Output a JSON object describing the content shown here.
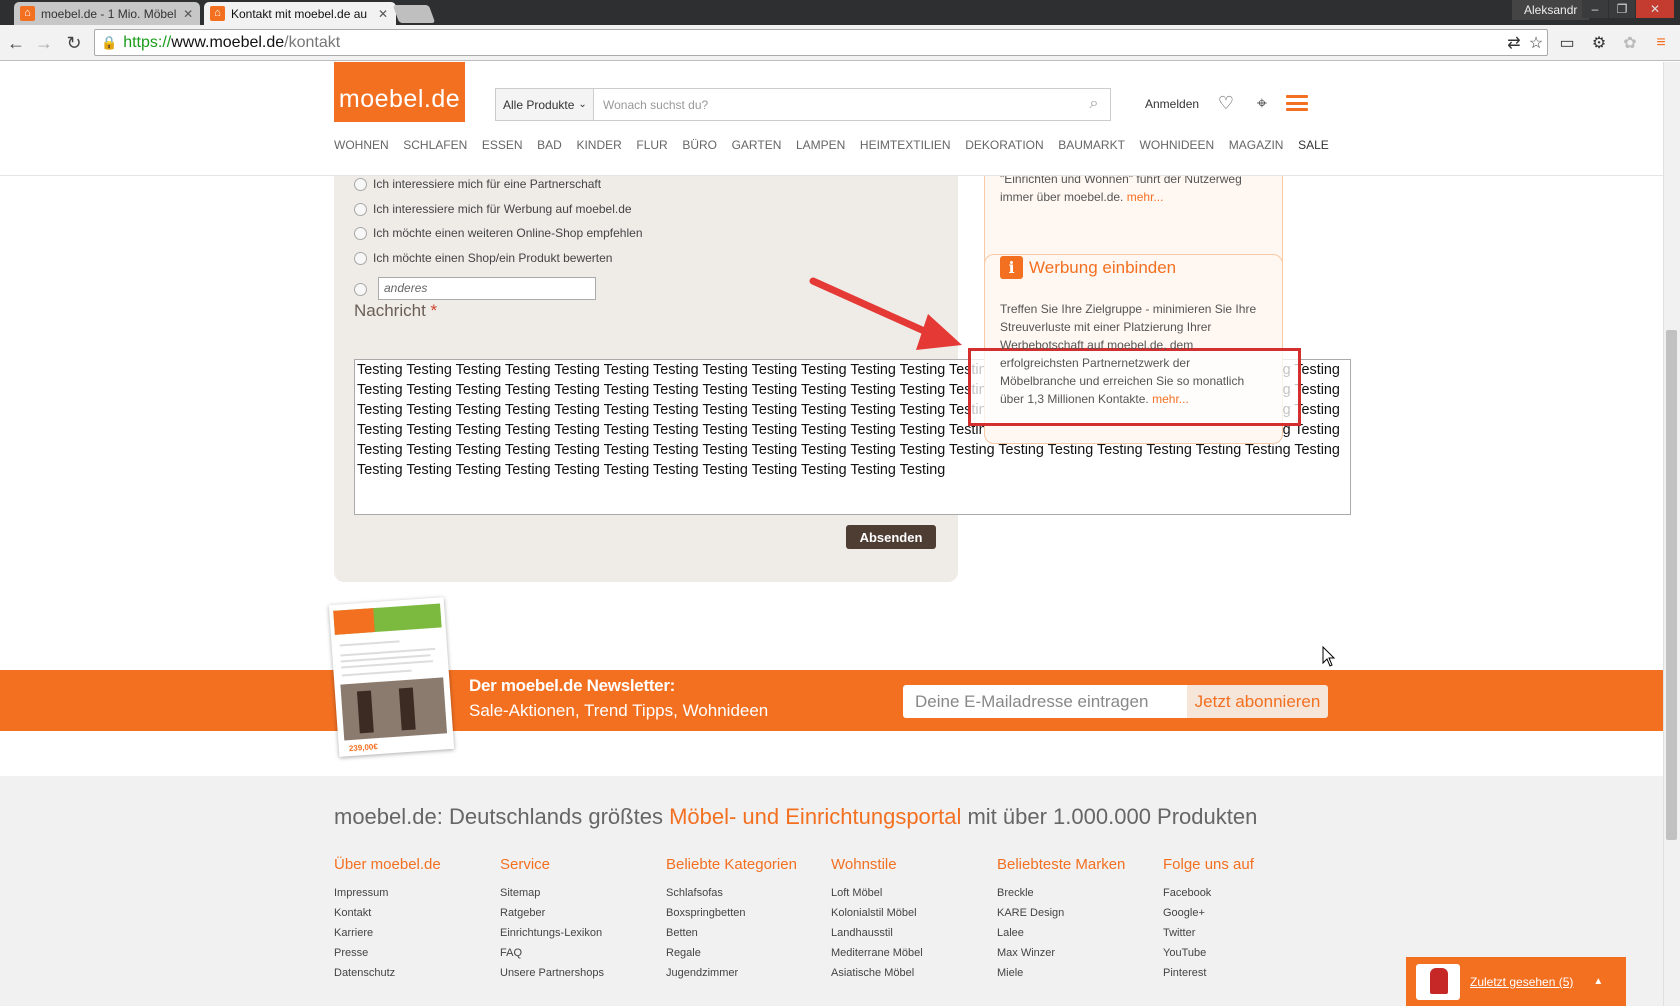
{
  "browser": {
    "tabs": [
      {
        "title": "moebel.de - 1 Mio. Möbel",
        "active": false
      },
      {
        "title": "Kontakt mit moebel.de au",
        "active": true
      }
    ],
    "user": "Aleksandr",
    "url": {
      "scheme": "https://",
      "host": "www.moebel.de",
      "path": "/kontakt"
    },
    "window_controls": [
      "–",
      "❐",
      "✕"
    ]
  },
  "header": {
    "logo": "moebel.de",
    "category_select": "Alle Produkte",
    "search_placeholder": "Wonach suchst du?",
    "login": "Anmelden",
    "nav": [
      "WOHNEN",
      "SCHLAFEN",
      "ESSEN",
      "BAD",
      "KINDER",
      "FLUR",
      "BÜRO",
      "GARTEN",
      "LAMPEN",
      "HEIMTEXTILIEN",
      "DEKORATION",
      "BAUMARKT",
      "WOHNIDEEN",
      "MAGAZIN",
      "SALE"
    ]
  },
  "form": {
    "options": [
      "Ich interessiere mich für eine Partnerschaft",
      "Ich interessiere mich für Werbung auf moebel.de",
      "Ich möchte einen weiteren Online-Shop empfehlen",
      "Ich möchte einen Shop/ein Produkt bewerten"
    ],
    "other_placeholder": "anderes",
    "message_label": "Nachricht",
    "required_marker": "*",
    "message_value": "Testing Testing Testing Testing Testing Testing Testing Testing Testing Testing Testing Testing Testing Testing Testing Testing Testing Testing Testing Testing Testing Testing Testing Testing Testing Testing Testing Testing Testing Testing Testing Testing Testing Testing Testing Testing Testing Testing Testing Testing Testing Testing Testing Testing Testing Testing Testing Testing Testing Testing Testing Testing Testing Testing Testing Testing Testing Testing Testing Testing Testing Testing Testing Testing Testing Testing Testing Testing Testing Testing Testing Testing Testing Testing Testing Testing Testing Testing Testing Testing Testing Testing Testing Testing Testing Testing Testing Testing Testing Testing Testing Testing Testing Testing Testing Testing Testing Testing Testing Testing Testing Testing Testing Testing Testing Testing Testing Testing Testing Testing Testing Testing",
    "submit": "Absenden"
  },
  "info_boxes": {
    "box1": {
      "text": "\"Einrichten und Wohnen\" führt der Nutzerweg immer über moebel.de.",
      "more": "mehr..."
    },
    "box2": {
      "icon": "i",
      "title": "Werbung einbinden",
      "text": "Treffen Sie Ihre Zielgruppe - minimieren Sie Ihre Streuverluste mit einer Platzierung Ihrer Werbebotschaft auf moebel.de, dem erfolgreichsten Partnernetzwerk der Möbelbranche und erreichen Sie so monatlich über 1,3 Millionen Kontakte.",
      "more": "mehr..."
    }
  },
  "newsletter": {
    "heading": "Der moebel.de Newsletter:",
    "subheading": "Sale-Aktionen, Trend Tipps, Wohnideen",
    "email_placeholder": "Deine E-Mailadresse eintragen",
    "button": "Jetzt abonnieren",
    "preview_price": "239,00€"
  },
  "footer": {
    "tagline_before": "moebel.de: Deutschlands größtes ",
    "tagline_highlight": "Möbel- und Einrichtungsportal",
    "tagline_after": " mit über 1.000.000 Produkten",
    "columns": [
      {
        "title": "Über moebel.de",
        "links": [
          "Impressum",
          "Kontakt",
          "Karriere",
          "Presse",
          "Datenschutz"
        ]
      },
      {
        "title": "Service",
        "links": [
          "Sitemap",
          "Ratgeber",
          "Einrichtungs-Lexikon",
          "FAQ",
          "Unsere Partnershops"
        ]
      },
      {
        "title": "Beliebte Kategorien",
        "links": [
          "Schlafsofas",
          "Boxspringbetten",
          "Betten",
          "Regale",
          "Jugendzimmer"
        ]
      },
      {
        "title": "Wohnstile",
        "links": [
          "Loft Möbel",
          "Kolonialstil Möbel",
          "Landhausstil",
          "Mediterrane Möbel",
          "Asiatische Möbel"
        ]
      },
      {
        "title": "Beliebteste Marken",
        "links": [
          "Breckle",
          "KARE Design",
          "Lalee",
          "Max Winzer",
          "Miele"
        ]
      },
      {
        "title": "Folge uns auf",
        "links": [
          "Facebook",
          "Google+",
          "Twitter",
          "YouTube",
          "Pinterest"
        ]
      }
    ]
  },
  "recently_viewed": {
    "label": "Zuletzt gesehen (5)"
  },
  "colors": {
    "brand": "#f37021",
    "annotation_red": "#d32f2f",
    "form_bg": "#efece8"
  }
}
